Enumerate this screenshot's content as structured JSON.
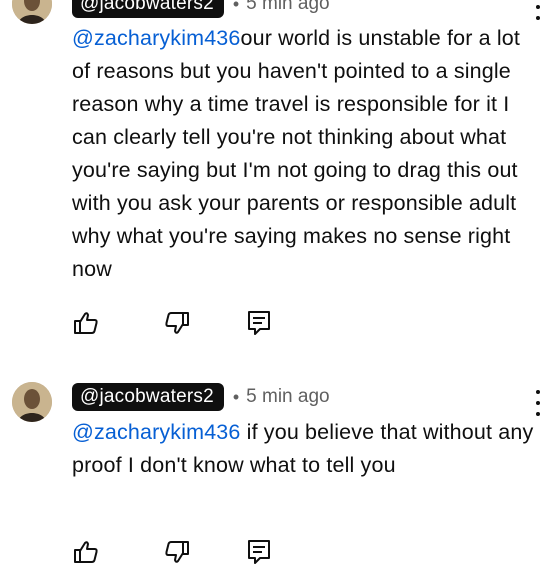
{
  "comments": [
    {
      "handle": "@jacobwaters2",
      "separator": "•",
      "time": "5 min ago",
      "mention": "@zacharykim436",
      "text": "our world is unstable for a lot of reasons but you haven't pointed to a single reason why a time travel is responsible for it I can clearly tell you're not thinking about what you're saying but I'm not going to drag this out with you ask your parents or responsible adult why what you're saying makes no sense right now",
      "actions": [
        "like-icon",
        "dislike-icon",
        "reply-icon"
      ]
    },
    {
      "handle": "@jacobwaters2",
      "separator": "•",
      "time": "5 min ago",
      "mention": "@zacharykim436",
      "text": " if you believe that without any proof I don't know what to tell you",
      "actions": [
        "like-icon",
        "dislike-icon",
        "reply-icon"
      ]
    }
  ],
  "colors": {
    "mention": "#065fd4",
    "handle_chip_bg": "#0f0f0f",
    "meta_text": "#606060"
  }
}
